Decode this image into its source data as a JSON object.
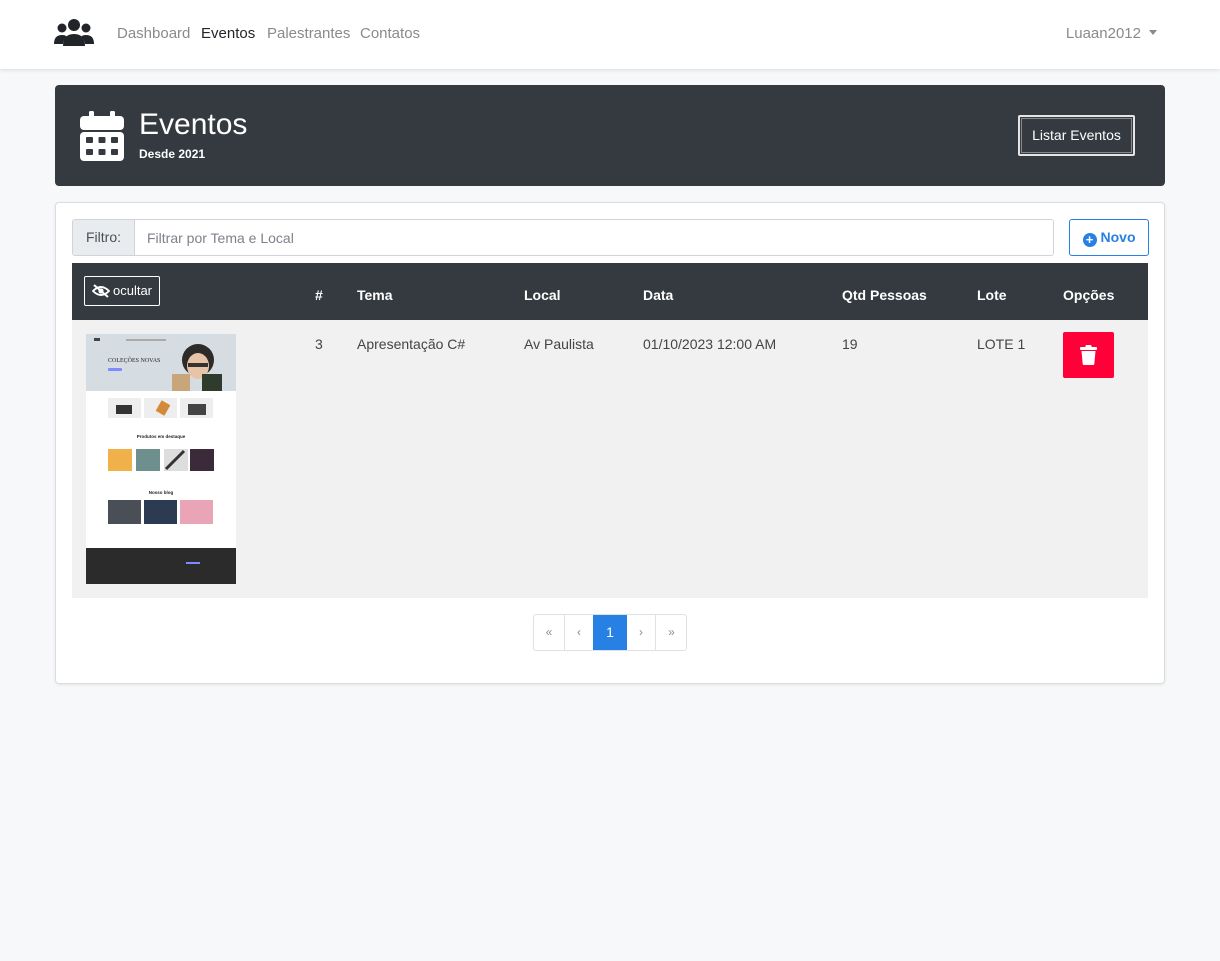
{
  "navbar": {
    "links": [
      "Dashboard",
      "Eventos",
      "Palestrantes",
      "Contatos"
    ],
    "active": "Eventos",
    "user": "Luaan2012"
  },
  "banner": {
    "title": "Eventos",
    "subtitle": "Desde 2021",
    "button_label": "Listar Eventos"
  },
  "filter": {
    "label": "Filtro:",
    "placeholder": "Filtrar por Tema e Local",
    "value": ""
  },
  "new_button_label": "Novo",
  "table": {
    "toggle_image_label": "ocultar",
    "columns": [
      "#",
      "Tema",
      "Local",
      "Data",
      "Qtd Pessoas",
      "Lote",
      "Opções"
    ],
    "rows": [
      {
        "id": "3",
        "tema": "Apresentação C#",
        "local": "Av Paulista",
        "data": "01/10/2023 12:00 AM",
        "qtd_pessoas": "19",
        "lote": "LOTE 1"
      }
    ]
  },
  "thumbnail": {
    "hero_text": "COLEÇÕES NOVAS",
    "section1": "Produtos em destaque",
    "section2": "Nosso blog"
  },
  "pagination": {
    "first": "«",
    "prev": "‹",
    "current": "1",
    "next": "›",
    "last": "»"
  },
  "colors": {
    "dark": "#343a40",
    "primary": "#2780e3",
    "danger": "#ff0039",
    "background": "#f7f8fa"
  },
  "icons": {
    "brand": "users-icon",
    "banner": "calendar-icon",
    "toggle": "eye-slash-icon",
    "new": "plus-circle-icon",
    "delete": "trash-icon"
  }
}
